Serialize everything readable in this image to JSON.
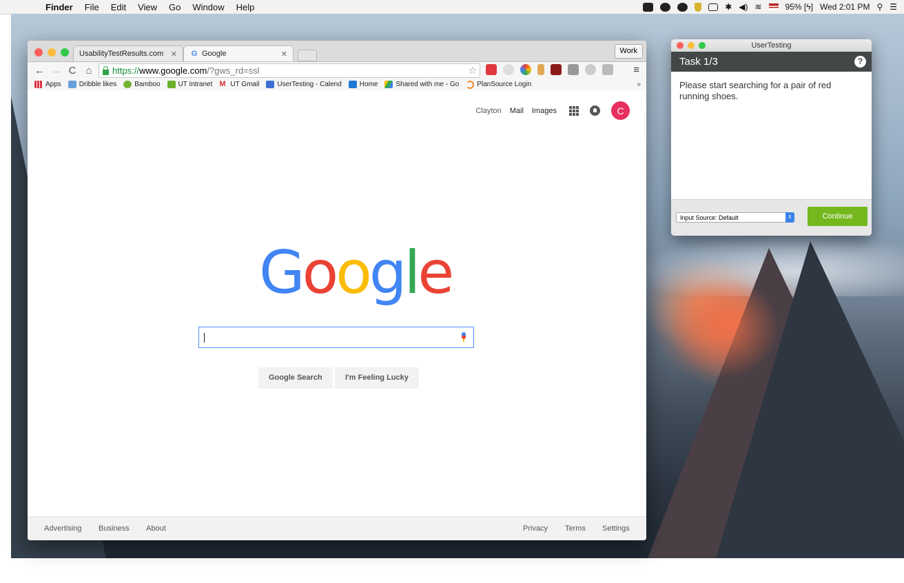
{
  "menubar": {
    "app": "Finder",
    "items": [
      "File",
      "Edit",
      "View",
      "Go",
      "Window",
      "Help"
    ],
    "battery": "95%",
    "clock": "Wed 2:01 PM",
    "icons": [
      "evernote-icon",
      "creative-cloud-icon",
      "adobe-icon",
      "shield-icon",
      "airplay-icon",
      "bluetooth-icon",
      "volume-icon",
      "wifi-icon",
      "flag-icon",
      "battery-icon",
      "spotlight-icon",
      "notification-center-icon"
    ]
  },
  "chrome": {
    "tabs": [
      {
        "label": "UsabilityTestResults.com",
        "favicon": "UT"
      },
      {
        "label": "Google",
        "favicon": "G"
      }
    ],
    "profile": "Work",
    "url": {
      "scheme": "https://",
      "host": "www.google.com",
      "path": "/?gws_rd=ssl"
    },
    "bookmarks": [
      "Apps",
      "Dribble likes",
      "Bamboo",
      "UT Intranet",
      "UT Gmail",
      "UserTesting - Calend",
      "Home",
      "Shared with me - Go",
      "PlanSource Login"
    ],
    "bookmarks_more": "»"
  },
  "google": {
    "top_links": {
      "user": "Clayton",
      "mail": "Mail",
      "images": "Images"
    },
    "avatar_letter": "C",
    "logo": [
      "G",
      "o",
      "o",
      "g",
      "l",
      "e"
    ],
    "search_button": "Google Search",
    "lucky_button": "I'm Feeling Lucky",
    "footer_left": [
      "Advertising",
      "Business",
      "About"
    ],
    "footer_right": [
      "Privacy",
      "Terms",
      "Settings"
    ]
  },
  "usertesting": {
    "window_title": "UserTesting",
    "task": "Task 1/3",
    "help": "?",
    "instruction": "Please start searching for a pair of red running shoes.",
    "input_source": "Input Source: Default",
    "continue": "Continue"
  },
  "colors": {
    "google_blue": "#4285f4",
    "google_red": "#ea4335",
    "google_yellow": "#fbbc05",
    "google_green": "#34a853",
    "continue_green": "#74b81e",
    "ut_header": "#444748"
  }
}
